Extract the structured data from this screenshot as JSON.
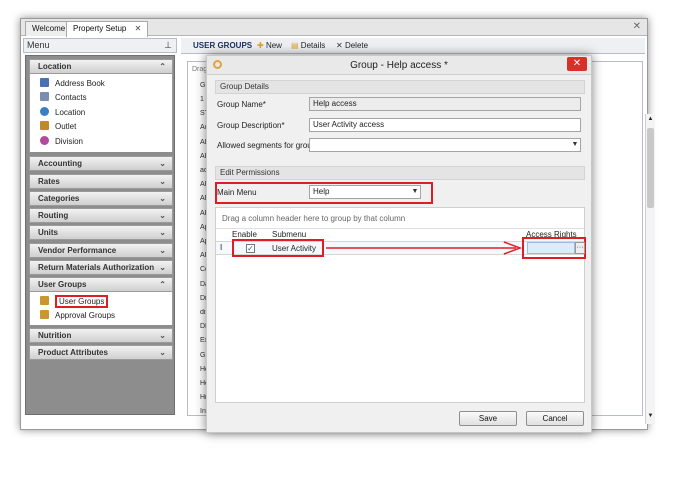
{
  "tabs": [
    {
      "label": "Welcome"
    },
    {
      "label": "Property Setup",
      "close": "✕"
    }
  ],
  "window_close": "✕",
  "menu": {
    "header": "Menu",
    "pin": "ꟷ",
    "groups": [
      {
        "label": "Location",
        "chevron": "≈",
        "items": [
          {
            "label": "Address Book",
            "icon": "address-book-icon",
            "color": "#4a6fb5"
          },
          {
            "label": "Contacts",
            "icon": "contacts-icon",
            "color": "#7a8fb0"
          },
          {
            "label": "Location",
            "icon": "location-icon",
            "color": "#3a7fc2"
          },
          {
            "label": "Outlet",
            "icon": "outlet-icon",
            "color": "#c08a2a"
          },
          {
            "label": "Division",
            "icon": "division-icon",
            "color": "#b04a9a"
          }
        ]
      },
      {
        "label": "Accounting",
        "chevron": "¥"
      },
      {
        "label": "Rates",
        "chevron": "¥"
      },
      {
        "label": "Categories",
        "chevron": "¥"
      },
      {
        "label": "Routing",
        "chevron": "¥"
      },
      {
        "label": "Units",
        "chevron": "¥"
      },
      {
        "label": "Vendor Performance",
        "chevron": "¥"
      },
      {
        "label": "Return Materials Authorization",
        "chevron": "¥"
      },
      {
        "label": "User Groups",
        "chevron": "≈",
        "items": [
          {
            "label": "User Groups",
            "icon": "user-groups-icon",
            "color": "#c9962f"
          },
          {
            "label": "Approval Groups",
            "icon": "approval-groups-icon",
            "color": "#c9962f"
          }
        ]
      },
      {
        "label": "Nutrition",
        "chevron": "¥"
      },
      {
        "label": "Product Attributes",
        "chevron": "¥"
      }
    ]
  },
  "toolbar": {
    "title": "USER GROUPS",
    "new_label": "New",
    "details_label": "Details",
    "delete_label": "Delete"
  },
  "backgrid": {
    "drag_hint": "Drag",
    "header": "Gr",
    "rows": [
      "1",
      "ST",
      "Ac",
      "AL",
      "AF",
      "ac",
      "AF",
      "AF",
      "AF",
      "Ap",
      "Ap",
      "AF",
      "Co",
      "Da",
      "Di",
      "dis",
      "DI",
      "Ex",
      "Gr",
      "He",
      "He",
      "Hi",
      "In"
    ]
  },
  "dialog": {
    "title": "Group - Help access *",
    "close": "✕",
    "group_details": {
      "section_label": "Group Details",
      "name_label": "Group Name*",
      "name_value": "Help access",
      "desc_label": "Group Description*",
      "desc_value": "User Activity access",
      "segments_label": "Allowed segments for group",
      "segments_value": ""
    },
    "edit_permissions": {
      "section_label": "Edit Permissions",
      "main_menu_label": "Main Menu",
      "main_menu_value": "Help",
      "drag_hint": "Drag a column header here to group by that column",
      "columns": {
        "enable": "Enable",
        "submenu": "Submenu",
        "access": "Access Rights"
      },
      "rows": [
        {
          "enabled": true,
          "submenu": "User Activity",
          "access": "",
          "ellipsis": "···",
          "cursor": "I"
        }
      ]
    },
    "save_label": "Save",
    "cancel_label": "Cancel"
  },
  "colors": {
    "highlight": "#e01c24",
    "nav_bg": "#8d8d8d",
    "dialog_close": "#d9302a"
  }
}
